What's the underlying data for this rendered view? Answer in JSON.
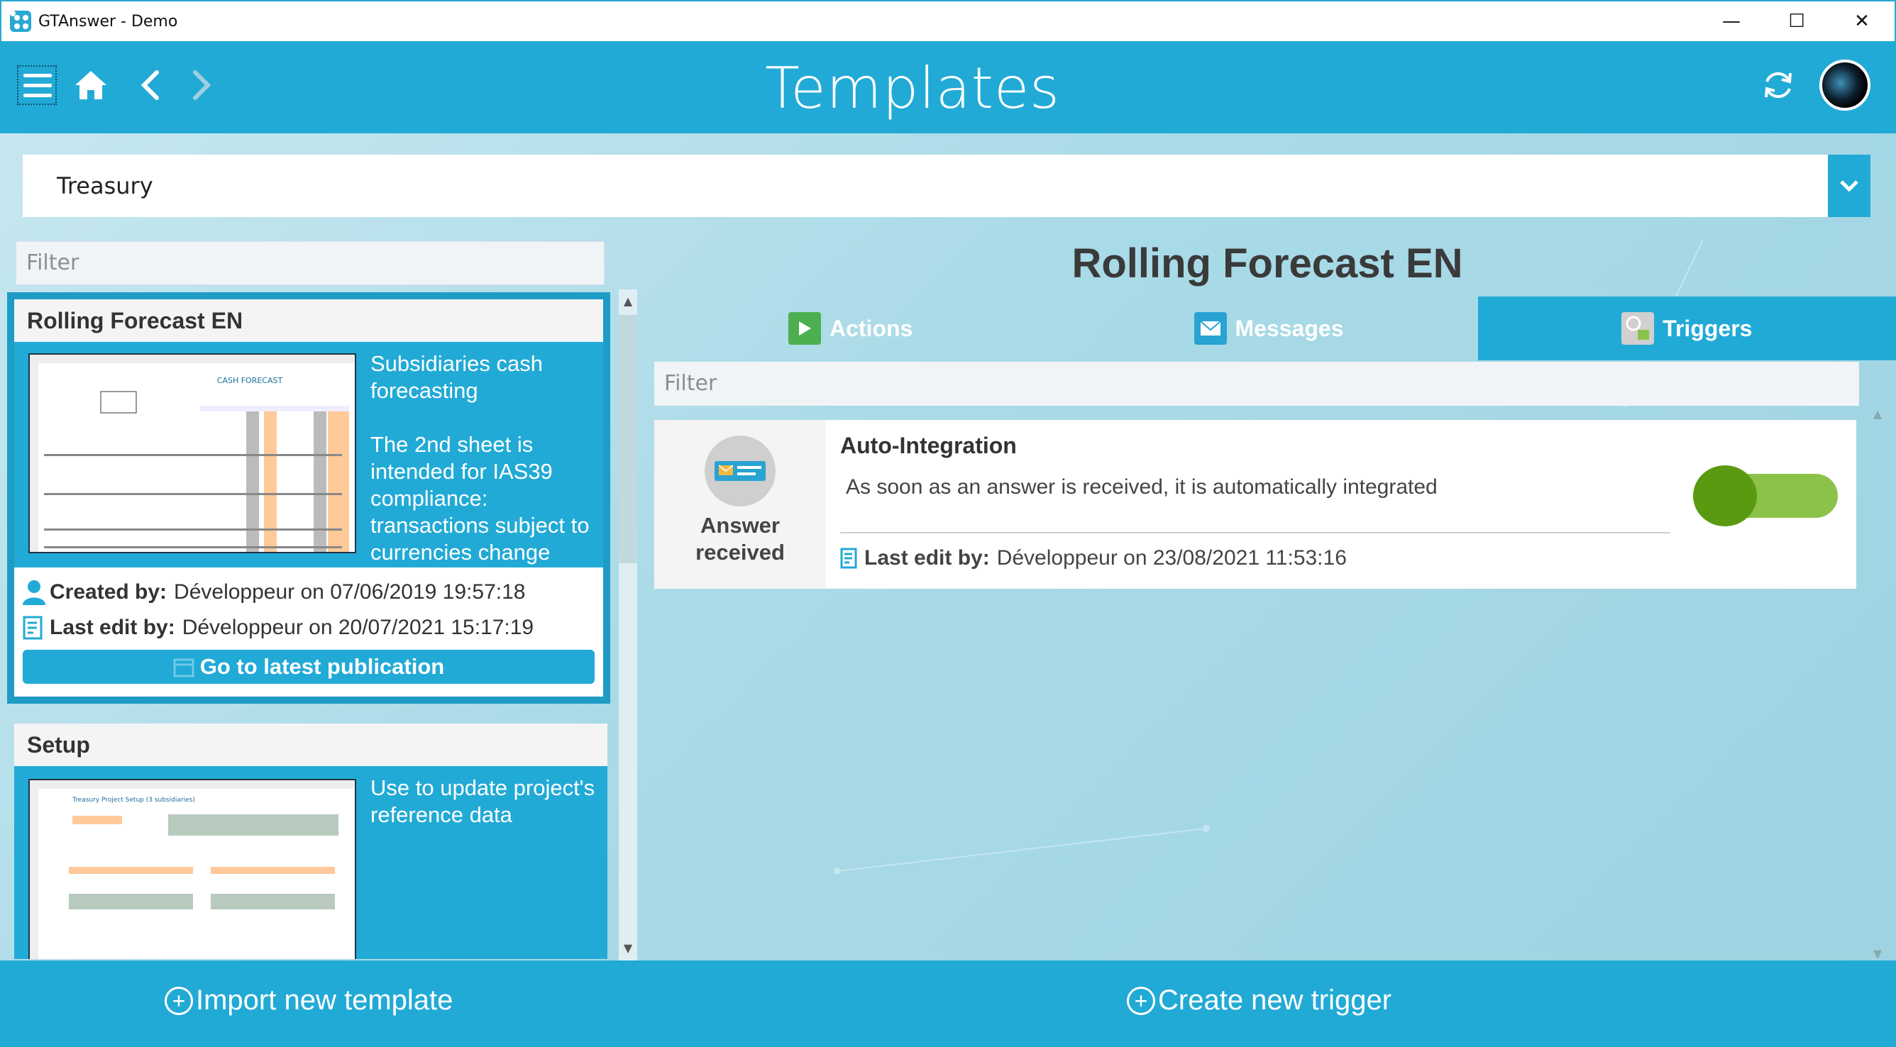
{
  "window": {
    "title": "GTAnswer - Demo",
    "minimize": "—",
    "maximize": "☐",
    "close": "✕"
  },
  "header": {
    "title": "Templates"
  },
  "category": {
    "selected": "Treasury"
  },
  "left": {
    "filter_placeholder": "Filter",
    "templates": [
      {
        "name": "Rolling Forecast EN",
        "thumbnail_title": "CASH FORECAST",
        "description": "Subsidiaries cash forecasting\n\nThe 2nd sheet is intended for IAS39 compliance: transactions subject to currencies change",
        "created_label": "Created by:",
        "created_value": "Développeur on 07/06/2019 19:57:18",
        "edit_label": "Last edit by:",
        "edit_value": "Développeur on 20/07/2021 15:17:19",
        "go_label": "Go to latest publication"
      },
      {
        "name": "Setup",
        "thumbnail_title": "Treasury Project Setup (3 subsidiaries)",
        "description": "Use to update project's reference data"
      }
    ]
  },
  "detail": {
    "title": "Rolling Forecast EN",
    "tabs": [
      {
        "label": "Actions",
        "icon": "play-icon",
        "color": "#4caf50"
      },
      {
        "label": "Messages",
        "icon": "envelope-icon",
        "color": "#29a3d2"
      },
      {
        "label": "Triggers",
        "icon": "trigger-icon",
        "color": "#9e9e9e"
      }
    ],
    "active_tab": "Triggers",
    "filter_placeholder": "Filter",
    "trigger": {
      "type_label": "Answer received",
      "name": "Auto-Integration",
      "description": "As soon as an answer is received, it is automatically integrated",
      "edit_label": "Last edit by:",
      "edit_value": "Développeur on 23/08/2021 11:53:16",
      "enabled": true
    }
  },
  "bottom": {
    "import_label": "Import new template",
    "create_label": "Create new trigger"
  },
  "colors": {
    "accent": "#22aad6",
    "toggle_on": "#8bc34a",
    "toggle_knob": "#5a9a10"
  }
}
